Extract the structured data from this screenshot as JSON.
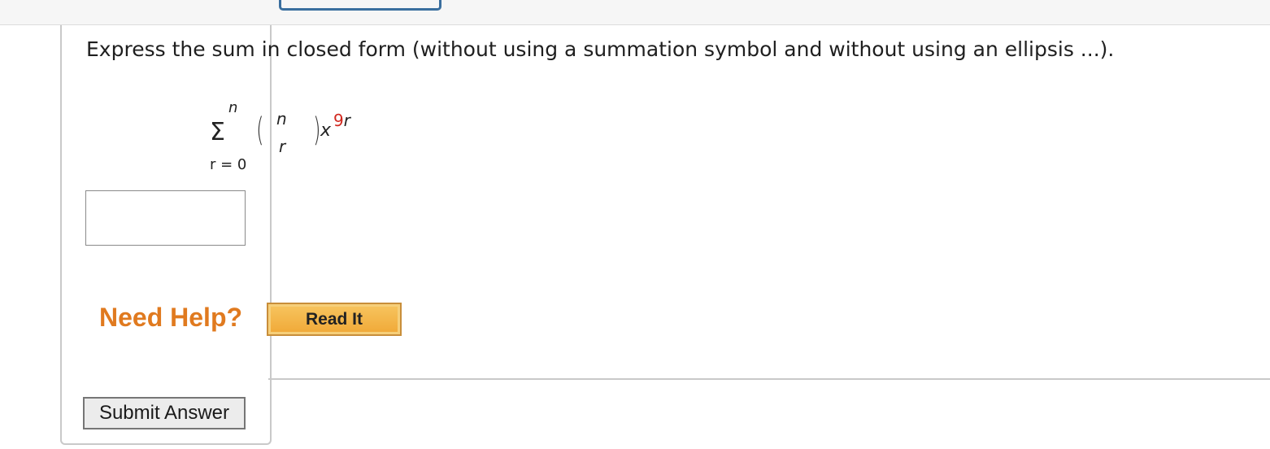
{
  "question": {
    "prompt": "Express the sum in closed form (without using a summation symbol and without using an ellipsis ...).",
    "math": {
      "sum_symbol": "Σ",
      "upper_limit": "n",
      "lower_limit": "r = 0",
      "binom_top": "n",
      "binom_bottom": "r",
      "paren_left": "(",
      "paren_right": ")",
      "base": "x",
      "exponent_coefficient": "9",
      "exponent_variable": "r"
    },
    "answer": {
      "value": "",
      "placeholder": ""
    }
  },
  "help": {
    "label": "Need Help?",
    "read_it_label": "Read It"
  },
  "actions": {
    "submit_label": "Submit Answer"
  },
  "colors": {
    "need_help": "#e07a1f",
    "exponent_coefficient": "#d1281f",
    "read_it_bg": "#f0a836",
    "top_tab_border": "#3a6e9e"
  }
}
